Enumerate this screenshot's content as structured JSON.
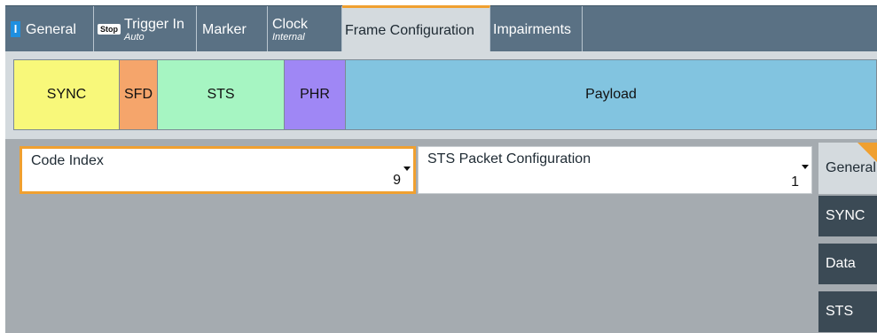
{
  "tabs": [
    {
      "icon": "I",
      "label": "General",
      "sub": ""
    },
    {
      "icon": "Stop",
      "label": "Trigger In",
      "sub": "Auto"
    },
    {
      "icon": "",
      "label": "Marker",
      "sub": ""
    },
    {
      "icon": "",
      "label": "Clock",
      "sub": "Internal"
    },
    {
      "icon": "",
      "label": "Frame Configuration",
      "sub": ""
    },
    {
      "icon": "",
      "label": "Impairments",
      "sub": ""
    }
  ],
  "frame": {
    "segments": [
      {
        "label": "SYNC",
        "color": "#f8f87a"
      },
      {
        "label": "SFD",
        "color": "#f5a56b"
      },
      {
        "label": "STS",
        "color": "#a6f5c2"
      },
      {
        "label": "PHR",
        "color": "#9f87f5"
      },
      {
        "label": "Payload",
        "color": "#82c4e0"
      }
    ]
  },
  "config": {
    "code_index": {
      "label": "Code Index",
      "value": "9"
    },
    "sts_packet": {
      "label": "STS Packet Configuration",
      "value": "1"
    }
  },
  "sidenav": [
    "General",
    "SYNC",
    "Data",
    "STS"
  ],
  "colors": {
    "accent": "#f0a030",
    "tabbar": "#5a7184",
    "panel": "#a5abb0"
  }
}
